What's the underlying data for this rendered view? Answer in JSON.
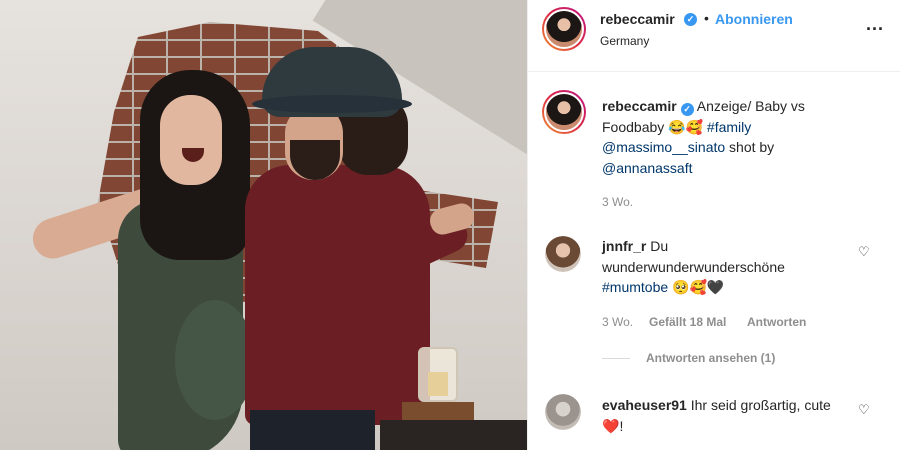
{
  "post": {
    "photo_alt_icon": "post-photo"
  },
  "header": {
    "username": "rebeccamir",
    "verified_icon": "verified-badge-icon",
    "separator": "•",
    "follow_label": "Abonnieren",
    "location": "Germany",
    "more_icon": "more-options-icon",
    "more_label": "..."
  },
  "caption": {
    "username": "rebeccamir",
    "text_part1": "Anzeige/ Baby vs Foodbaby 😂🥰",
    "hashtag": "#family",
    "mention1": "@massimo__sinato",
    "text_part2": "shot by",
    "mention2": "@annanassaft",
    "time": "3 Wo."
  },
  "comments": [
    {
      "username": "jnnfr_r",
      "text": "Du wunderwunderwunderschöne",
      "hashtag": "#mumtobe",
      "emojis": "🥺🥰🖤",
      "time": "3 Wo.",
      "likes": "Gefällt 18 Mal",
      "reply_label": "Antworten",
      "view_replies": "Antworten ansehen (1)"
    },
    {
      "username": "evaheuser91",
      "text": "Ihr seid großartig, cute",
      "emoji": "❤️",
      "trailing": "!"
    }
  ],
  "colors": {
    "accent": "#3897f0",
    "link": "#00376b",
    "muted": "#8e8e8e"
  }
}
